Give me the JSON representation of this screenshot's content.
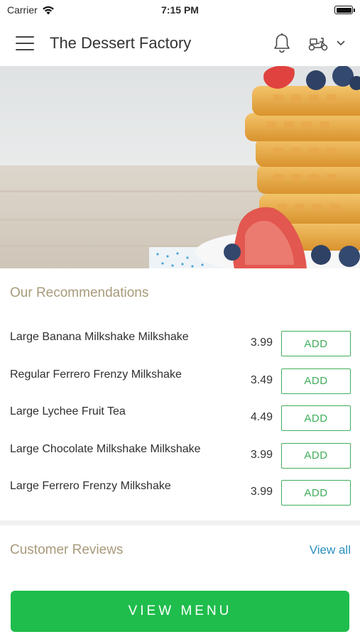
{
  "status_bar": {
    "carrier": "Carrier",
    "time": "7:15 PM"
  },
  "app_bar": {
    "title": "The Dessert Factory",
    "icons": [
      "hamburger-menu-icon",
      "bell-icon",
      "scooter-icon",
      "chevron-down-icon"
    ]
  },
  "hero": {
    "subject": "stack of waffles with strawberries and blueberries"
  },
  "recommendations": {
    "title": "Our Recommendations",
    "add_label": "ADD",
    "items": [
      {
        "name": "Large Banana Milkshake Milkshake",
        "price": "3.99"
      },
      {
        "name": "Regular Ferrero Frenzy Milkshake",
        "price": "3.49"
      },
      {
        "name": "Large Lychee Fruit Tea",
        "price": "4.49"
      },
      {
        "name": "Large Chocolate Milkshake Milkshake",
        "price": "3.99"
      },
      {
        "name": "Large Ferrero Frenzy Milkshake",
        "price": "3.99"
      }
    ]
  },
  "reviews": {
    "title": "Customer Reviews",
    "view_all": "View all"
  },
  "footer": {
    "view_menu": "VIEW MENU"
  },
  "colors": {
    "accent_green": "#1fbd4c",
    "add_border": "#3fae5a",
    "section_title": "#a89a7a",
    "link_blue": "#2a8fc0"
  }
}
